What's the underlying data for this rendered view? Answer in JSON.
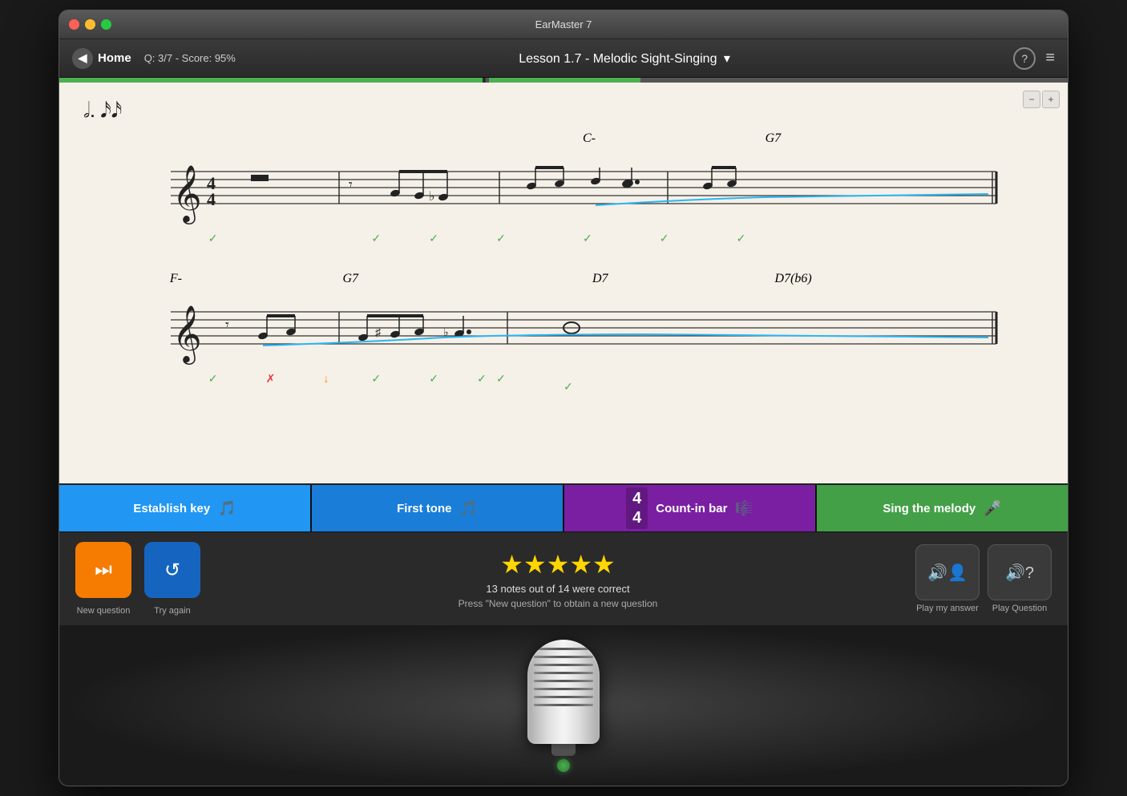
{
  "window": {
    "title": "EarMaster 7"
  },
  "header": {
    "home_label": "Home",
    "score": "Q: 3/7 - Score: 95%",
    "lesson_title": "Lesson 1.7 - Melodic Sight-Singing",
    "lesson_arrow": "▾",
    "help_icon": "?",
    "menu_icon": "≡"
  },
  "progress": {
    "bar1_width": "42%",
    "bar2_width": "15%"
  },
  "zoom": {
    "zoom_in": "⊕",
    "zoom_out": "⊖"
  },
  "action_buttons": [
    {
      "id": "establish",
      "label": "Establish key",
      "icon": "♩",
      "color": "#2196f3"
    },
    {
      "id": "first-tone",
      "label": "First tone",
      "icon": "♩",
      "color": "#1a7dd8"
    },
    {
      "id": "count-in",
      "label": "Count-in bar",
      "num_top": "4",
      "num_bot": "4",
      "icon": "𝄡",
      "color": "#7b1fa2"
    },
    {
      "id": "sing",
      "label": "Sing the melody",
      "icon": "🎤",
      "color": "#43a047"
    }
  ],
  "results": {
    "new_question_label": "New question",
    "try_again_label": "Try again",
    "stars": "★★★★★",
    "score_note": "13 notes out of 14 were correct",
    "score_hint": "Press \"New question\" to obtain a new question",
    "play_answer_label": "Play my answer",
    "play_question_label": "Play Question"
  },
  "chord_labels_row1": [
    {
      "text": "C-",
      "x": 52
    },
    {
      "text": "G7",
      "x": 71
    }
  ],
  "chord_labels_row2": [
    {
      "text": "F-",
      "x": 10
    },
    {
      "text": "G7",
      "x": 29
    },
    {
      "text": "D7",
      "x": 55
    },
    {
      "text": "D7(b6)",
      "x": 74
    }
  ]
}
